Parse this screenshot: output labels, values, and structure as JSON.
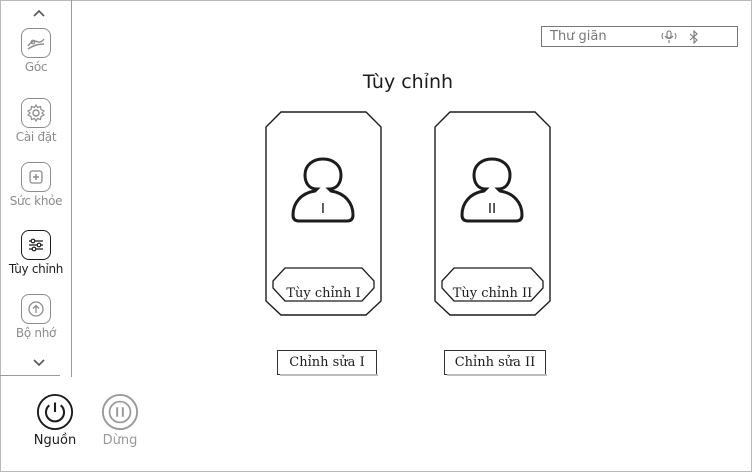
{
  "sidebar": {
    "items": [
      {
        "id": "angle",
        "label": "Góc",
        "icon": "recline-icon",
        "active": false
      },
      {
        "id": "settings",
        "label": "Cài đặt",
        "icon": "gear-icon",
        "active": false
      },
      {
        "id": "health",
        "label": "Sức khỏe",
        "icon": "health-plus-icon",
        "active": false
      },
      {
        "id": "custom",
        "label": "Tùy chỉnh",
        "icon": "sliders-icon",
        "active": true
      },
      {
        "id": "memory",
        "label": "Bộ nhớ",
        "icon": "memory-icon",
        "active": false
      }
    ]
  },
  "status": {
    "mode": "Thư giãn",
    "icons": [
      "voice-icon",
      "bluetooth-icon"
    ]
  },
  "main": {
    "title": "Tùy chỉnh",
    "cards": [
      {
        "label": "Tùy chỉnh I",
        "profile_glyph": "I"
      },
      {
        "label": "Tùy chỉnh II",
        "profile_glyph": "II"
      }
    ],
    "edit_buttons": [
      {
        "label": "Chỉnh sửa I"
      },
      {
        "label": "Chỉnh sửa II"
      }
    ]
  },
  "controls": {
    "power_label": "Nguồn",
    "pause_label": "Dừng"
  },
  "colors": {
    "active": "#1c1c1c",
    "inactive": "#8c8c8c",
    "border": "#9a9a9a"
  }
}
